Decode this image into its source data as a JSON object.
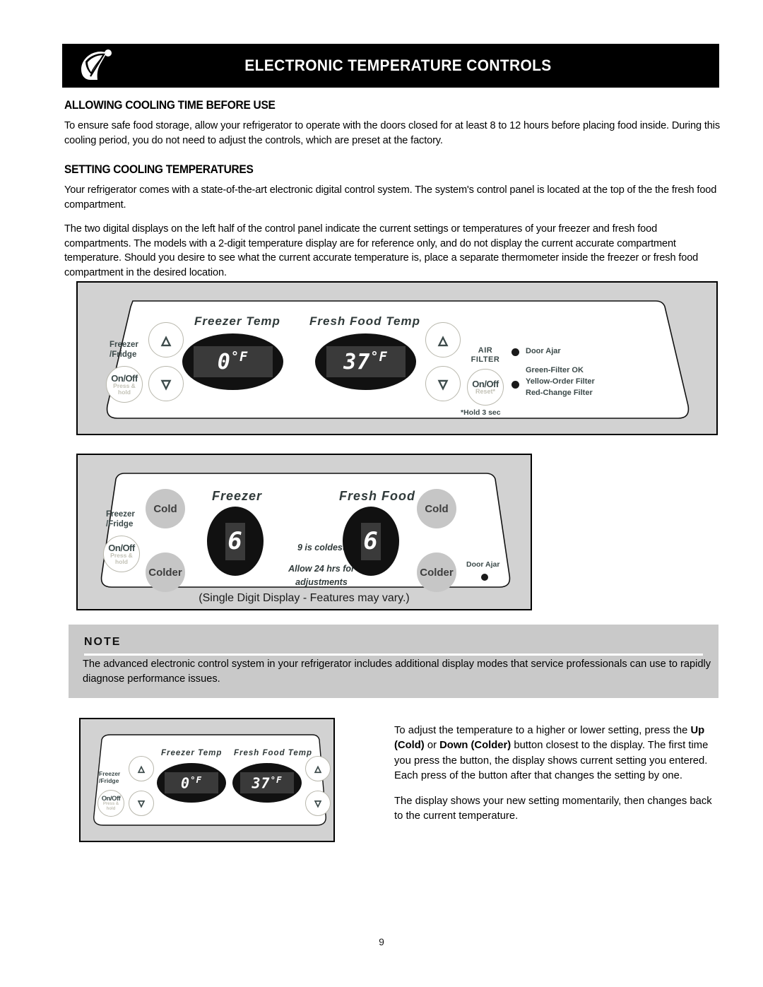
{
  "header": {
    "title": "ELECTRONIC TEMPERATURE CONTROLS",
    "logo_icon": "leaf-swirl-logo"
  },
  "sections": [
    {
      "heading": "ALLOWING COOLING TIME BEFORE USE",
      "paragraphs": [
        "To ensure safe food storage, allow your refrigerator to operate with the doors closed for at least 8 to 12 hours before placing food inside. During this cooling period, you do not need to adjust the controls, which are preset at the factory."
      ]
    },
    {
      "heading": "SETTING COOLING TEMPERATURES",
      "paragraphs": [
        "Your refrigerator comes with a state-of-the-art electronic digital control system. The system's control panel is located at the top of the the fresh food compartment.",
        "The two digital displays on the left half of the control panel indicate the current settings or temperatures of your freezer and fresh food compartments. The models with a 2-digit temperature display are for reference only, and do not display the current accurate compartment temperature.  Should you desire to see what the current accurate temperature is, place a separate thermometer inside the freezer or fresh food compartment in the desired location."
      ]
    }
  ],
  "panel_two_digit": {
    "freezer_fridge_label": "Freezer\n/Fridge",
    "onoff_label": "On/Off",
    "onoff_sub": "Press &\nhold",
    "up_icon": "chevron-up-icon",
    "down_icon": "chevron-down-icon",
    "freezer_title": "Freezer Temp",
    "fresh_food_title": "Fresh Food Temp",
    "freezer_value": "0",
    "freezer_unit": "°F",
    "fresh_food_value": "37",
    "fresh_food_unit": "°F",
    "air_filter_label": "AIR\nFILTER",
    "air_filter_onoff": "On/Off",
    "air_filter_reset": "Reset*",
    "hold_note": "*Hold 3 sec",
    "door_ajar_label": "Door Ajar",
    "filter_status": "Green-Filter OK\nYellow-Order Filter\nRed-Change Filter"
  },
  "panel_single_digit": {
    "freezer_fridge_label": "Freezer\n/Fridge",
    "onoff_label": "On/Off",
    "onoff_sub": "Press &\nhold",
    "cold_label": "Cold",
    "colder_label": "Colder",
    "freezer_title": "Freezer",
    "fresh_food_title": "Fresh Food",
    "freezer_value": "6",
    "fresh_food_value": "6",
    "hint_coldest": "9 is coldest",
    "hint_adjust": "Allow 24 hrs for\nadjustments",
    "door_ajar_label": "Door Ajar",
    "caption": "(Single Digit Display - Features may vary.)"
  },
  "note": {
    "title": "NOTE",
    "body": "The advanced electronic control system in your refrigerator includes additional display modes that service professionals can use to rapidly diagnose performance issues."
  },
  "panel_bottom": {
    "freezer_fridge_label": "Freezer\n/Fridge",
    "onoff_label": "On/Off",
    "onoff_sub": "Press &\nhold",
    "freezer_title": "Freezer Temp",
    "fresh_food_title": "Fresh Food Temp",
    "freezer_value": "0",
    "freezer_unit": "°F",
    "fresh_food_value": "37",
    "fresh_food_unit": "°F"
  },
  "bottom_text": {
    "p1_a": "To adjust the temperature to a higher or lower setting, press the ",
    "p1_b1": "Up (Cold)",
    "p1_c": " or ",
    "p1_b2": "Down (Colder)",
    "p1_d": " button closest to the display. The first time you press the button, the display shows current setting you entered. Each press of the button after that changes the setting by one.",
    "p2": "The display shows your new setting momentarily, then changes back to the current temperature."
  },
  "page_number": "9"
}
